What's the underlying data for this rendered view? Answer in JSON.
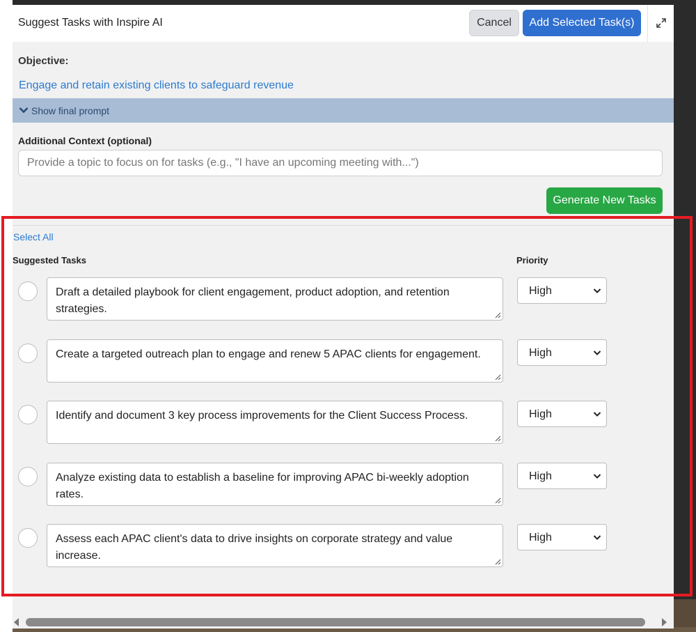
{
  "header": {
    "title": "Suggest Tasks with Inspire AI",
    "cancel_label": "Cancel",
    "add_label": "Add Selected Task(s)",
    "expand_icon": "expand-icon"
  },
  "objective": {
    "label": "Objective:",
    "text": "Engage and retain existing clients to safeguard revenue"
  },
  "prompt_toggle": {
    "label": "Show final prompt",
    "icon": "chevron-down-icon"
  },
  "context": {
    "label": "Additional Context (optional)",
    "placeholder": "Provide a topic to focus on for tasks (e.g., \"I have an upcoming meeting with...\")",
    "value": ""
  },
  "generate_label": "Generate New Tasks",
  "select_all_label": "Select All",
  "columns": {
    "tasks": "Suggested Tasks",
    "priority": "Priority"
  },
  "tasks": [
    {
      "text": "Draft a detailed playbook for client engagement, product adoption, and retention strategies.",
      "priority": "High"
    },
    {
      "text": "Create a targeted outreach plan to engage and renew 5 APAC clients for engagement.",
      "priority": "High"
    },
    {
      "text": "Identify and document 3 key process improvements for the Client Success Process.",
      "priority": "High"
    },
    {
      "text": "Analyze existing data to establish a baseline for improving APAC bi-weekly adoption rates.",
      "priority": "High"
    },
    {
      "text": "Assess each APAC client's data to drive insights on corporate strategy and value increase.",
      "priority": "High"
    }
  ],
  "colors": {
    "primary": "#2f6fd0",
    "success": "#28a745",
    "link": "#2c7bd0",
    "prompt_bar": "#a8bcd6",
    "highlight": "#e41b23"
  }
}
